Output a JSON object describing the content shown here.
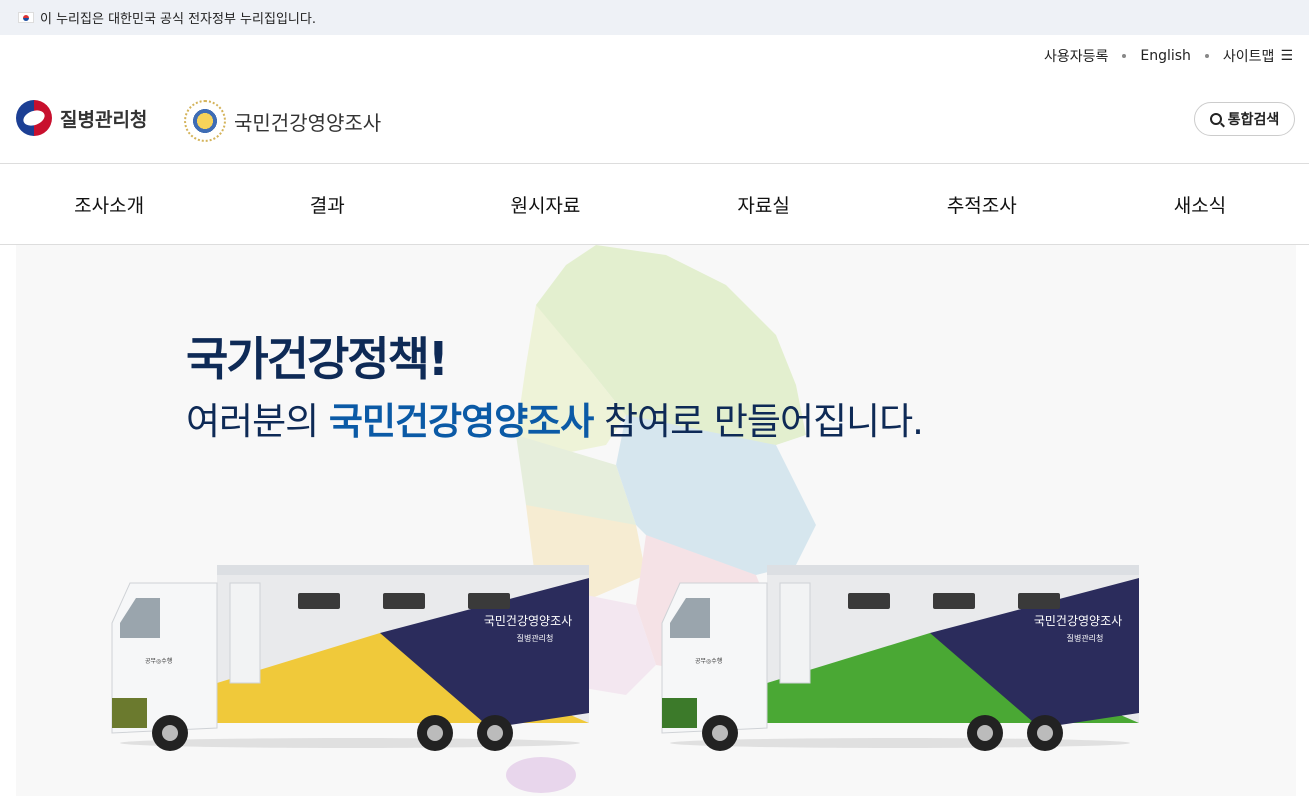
{
  "gov_banner": {
    "text": "이 누리집은 대한민국 공식 전자정부 누리집입니다."
  },
  "utility_nav": {
    "register": "사용자등록",
    "english": "English",
    "sitemap": "사이트맵"
  },
  "header": {
    "kdca_name": "질병관리청",
    "site_name": "국민건강영양조사",
    "search_label": "통합검색"
  },
  "gnb": {
    "items": [
      "조사소개",
      "결과",
      "원시자료",
      "자료실",
      "추적조사",
      "새소식"
    ]
  },
  "hero": {
    "title": "국가건강정책!",
    "subtitle_pre": "여러분의 ",
    "subtitle_accent": "국민건강영양조사",
    "subtitle_post": " 참여로 만들어집니다.",
    "truck_brand": "국민건강영양조사",
    "truck_agency": "질병관리청",
    "truck_plate": "공무◎수행"
  },
  "colors": {
    "accent_blue": "#0b5aa6",
    "navy": "#0e2a56",
    "truck_yellow": "#f0c93a",
    "truck_green": "#4aa834",
    "truck_navy": "#2b2c5c"
  }
}
